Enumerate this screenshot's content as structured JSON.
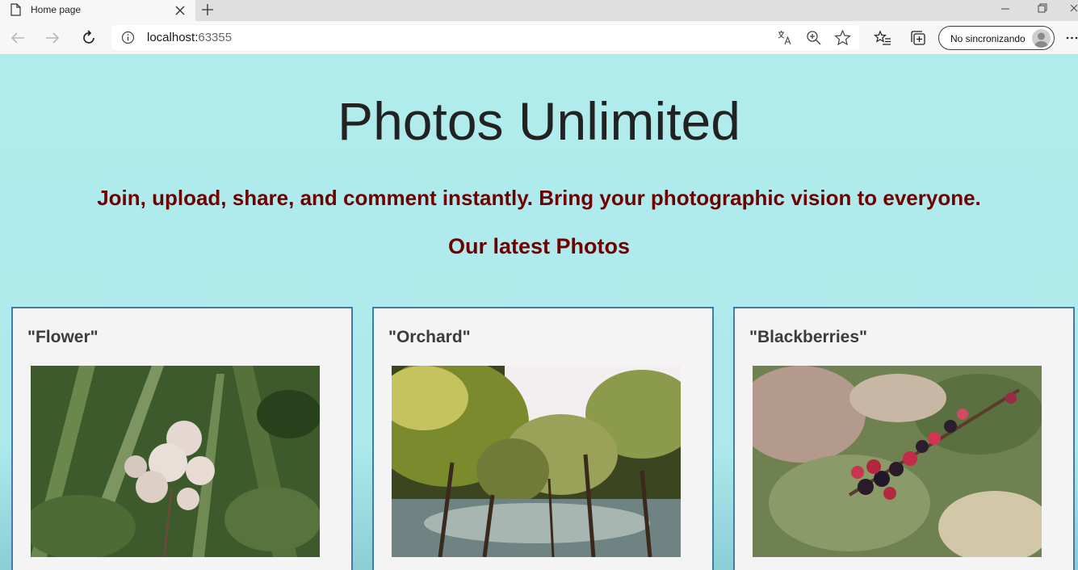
{
  "browser": {
    "tab_title": "Home page",
    "url_host": "localhost:",
    "url_port": "63355",
    "profile_label": "No sincronizando"
  },
  "page": {
    "title": "Photos Unlimited",
    "tagline": "Join, upload, share, and comment instantly. Bring your photographic vision to everyone.",
    "section_heading": "Our latest Photos",
    "photos": [
      {
        "title": "\"Flower\""
      },
      {
        "title": "\"Orchard\""
      },
      {
        "title": "\"Blackberries\""
      }
    ]
  },
  "colors": {
    "page_background": "#aeeaeb",
    "heading_red": "#700000",
    "card_border": "#3d7dae",
    "card_background": "#f4f4f4"
  }
}
